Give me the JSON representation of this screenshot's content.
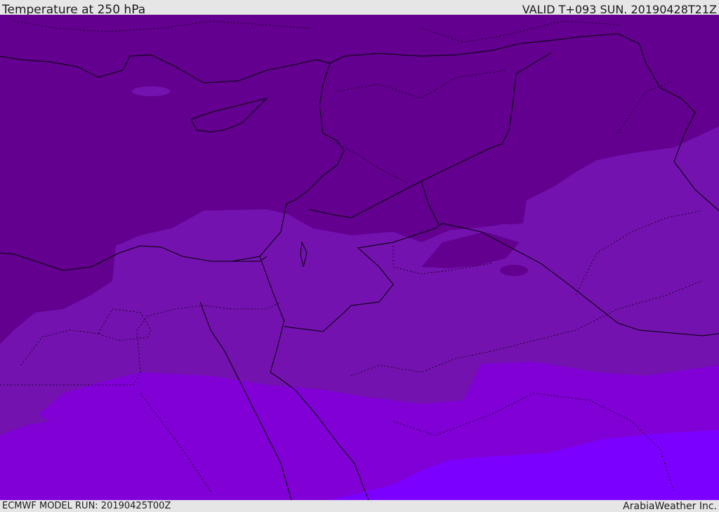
{
  "header": {
    "title": "Temperature at 250 hPa",
    "valid": "VALID T+093 SUN. 20190428T21Z"
  },
  "footer": {
    "model_run": "ECMWF MODEL RUN: 20190425T00Z",
    "credit": "ArabiaWeather Inc."
  },
  "map": {
    "colors": {
      "coldest_band": "#630090",
      "cold_band": "#7412b0",
      "mild_band": "#8000d6",
      "warmest_band": "#7c00ff",
      "border": "#000000"
    }
  }
}
